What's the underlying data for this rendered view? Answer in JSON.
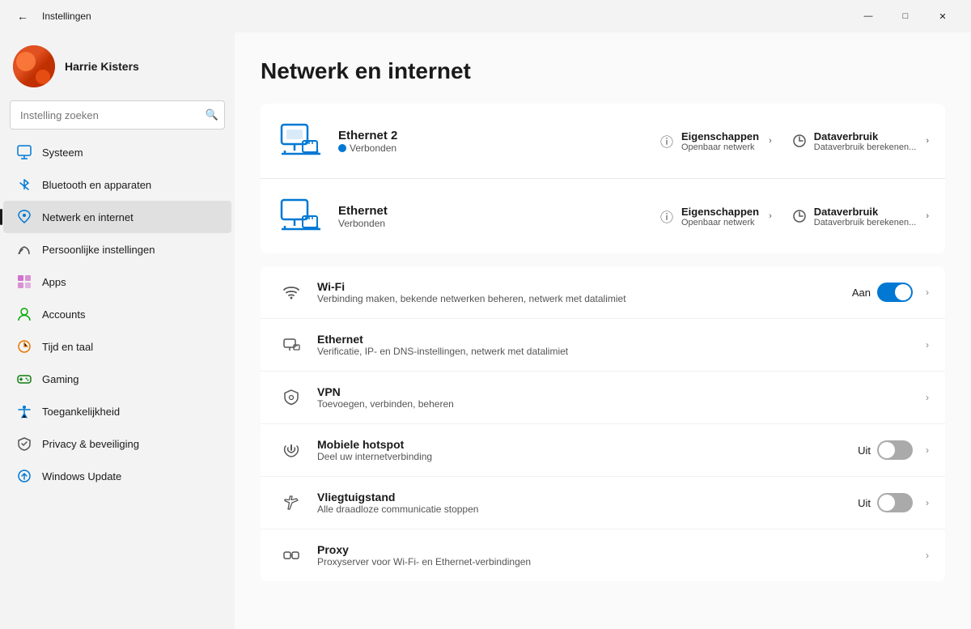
{
  "titlebar": {
    "title": "Instellingen",
    "back_icon": "←",
    "minimize": "—",
    "maximize": "□",
    "close": "✕"
  },
  "user": {
    "name": "Harrie Kisters"
  },
  "search": {
    "placeholder": "Instelling zoeken"
  },
  "nav": {
    "items": [
      {
        "id": "systeem",
        "label": "Systeem",
        "icon_type": "systeem"
      },
      {
        "id": "bluetooth",
        "label": "Bluetooth en apparaten",
        "icon_type": "bluetooth"
      },
      {
        "id": "netwerk",
        "label": "Netwerk en internet",
        "icon_type": "netwerk",
        "active": true
      },
      {
        "id": "persoonlijk",
        "label": "Persoonlijke instellingen",
        "icon_type": "persoonlijk"
      },
      {
        "id": "apps",
        "label": "Apps",
        "icon_type": "apps"
      },
      {
        "id": "accounts",
        "label": "Accounts",
        "icon_type": "accounts"
      },
      {
        "id": "tijd",
        "label": "Tijd en taal",
        "icon_type": "tijd"
      },
      {
        "id": "gaming",
        "label": "Gaming",
        "icon_type": "gaming"
      },
      {
        "id": "toegankelijkheid",
        "label": "Toegankelijkheid",
        "icon_type": "toegankelijkheid"
      },
      {
        "id": "privacy",
        "label": "Privacy & beveiliging",
        "icon_type": "privacy"
      },
      {
        "id": "update",
        "label": "Windows Update",
        "icon_type": "update"
      }
    ]
  },
  "page": {
    "title": "Netwerk en internet",
    "ethernet2": {
      "name": "Ethernet 2",
      "status": "Verbonden",
      "eigenschappen_label": "Eigenschappen",
      "eigenschappen_sub": "Openbaar netwerk",
      "dataverbruik_label": "Dataverbruik",
      "dataverbruik_sub": "Dataverbruik berekenen..."
    },
    "ethernet": {
      "name": "Ethernet",
      "status": "Verbonden",
      "eigenschappen_label": "Eigenschappen",
      "eigenschappen_sub": "Openbaar netwerk",
      "dataverbruik_label": "Dataverbruik",
      "dataverbruik_sub": "Dataverbruik berekenen..."
    },
    "network_items": [
      {
        "id": "wifi",
        "name": "Wi-Fi",
        "desc": "Verbinding maken, bekende netwerken beheren, netwerk met datalimiet",
        "toggle": true,
        "toggle_state": "on",
        "toggle_label": "Aan"
      },
      {
        "id": "ethernet",
        "name": "Ethernet",
        "desc": "Verificatie, IP- en DNS-instellingen, netwerk met datalimiet",
        "toggle": false
      },
      {
        "id": "vpn",
        "name": "VPN",
        "desc": "Toevoegen, verbinden, beheren",
        "toggle": false
      },
      {
        "id": "hotspot",
        "name": "Mobiele hotspot",
        "desc": "Deel uw internetverbinding",
        "toggle": true,
        "toggle_state": "off",
        "toggle_label": "Uit"
      },
      {
        "id": "vliegtuig",
        "name": "Vliegtuigstand",
        "desc": "Alle draadloze communicatie stoppen",
        "toggle": true,
        "toggle_state": "off",
        "toggle_label": "Uit"
      },
      {
        "id": "proxy",
        "name": "Proxy",
        "desc": "Proxyserver voor Wi-Fi- en Ethernet-verbindingen",
        "toggle": false
      }
    ]
  }
}
